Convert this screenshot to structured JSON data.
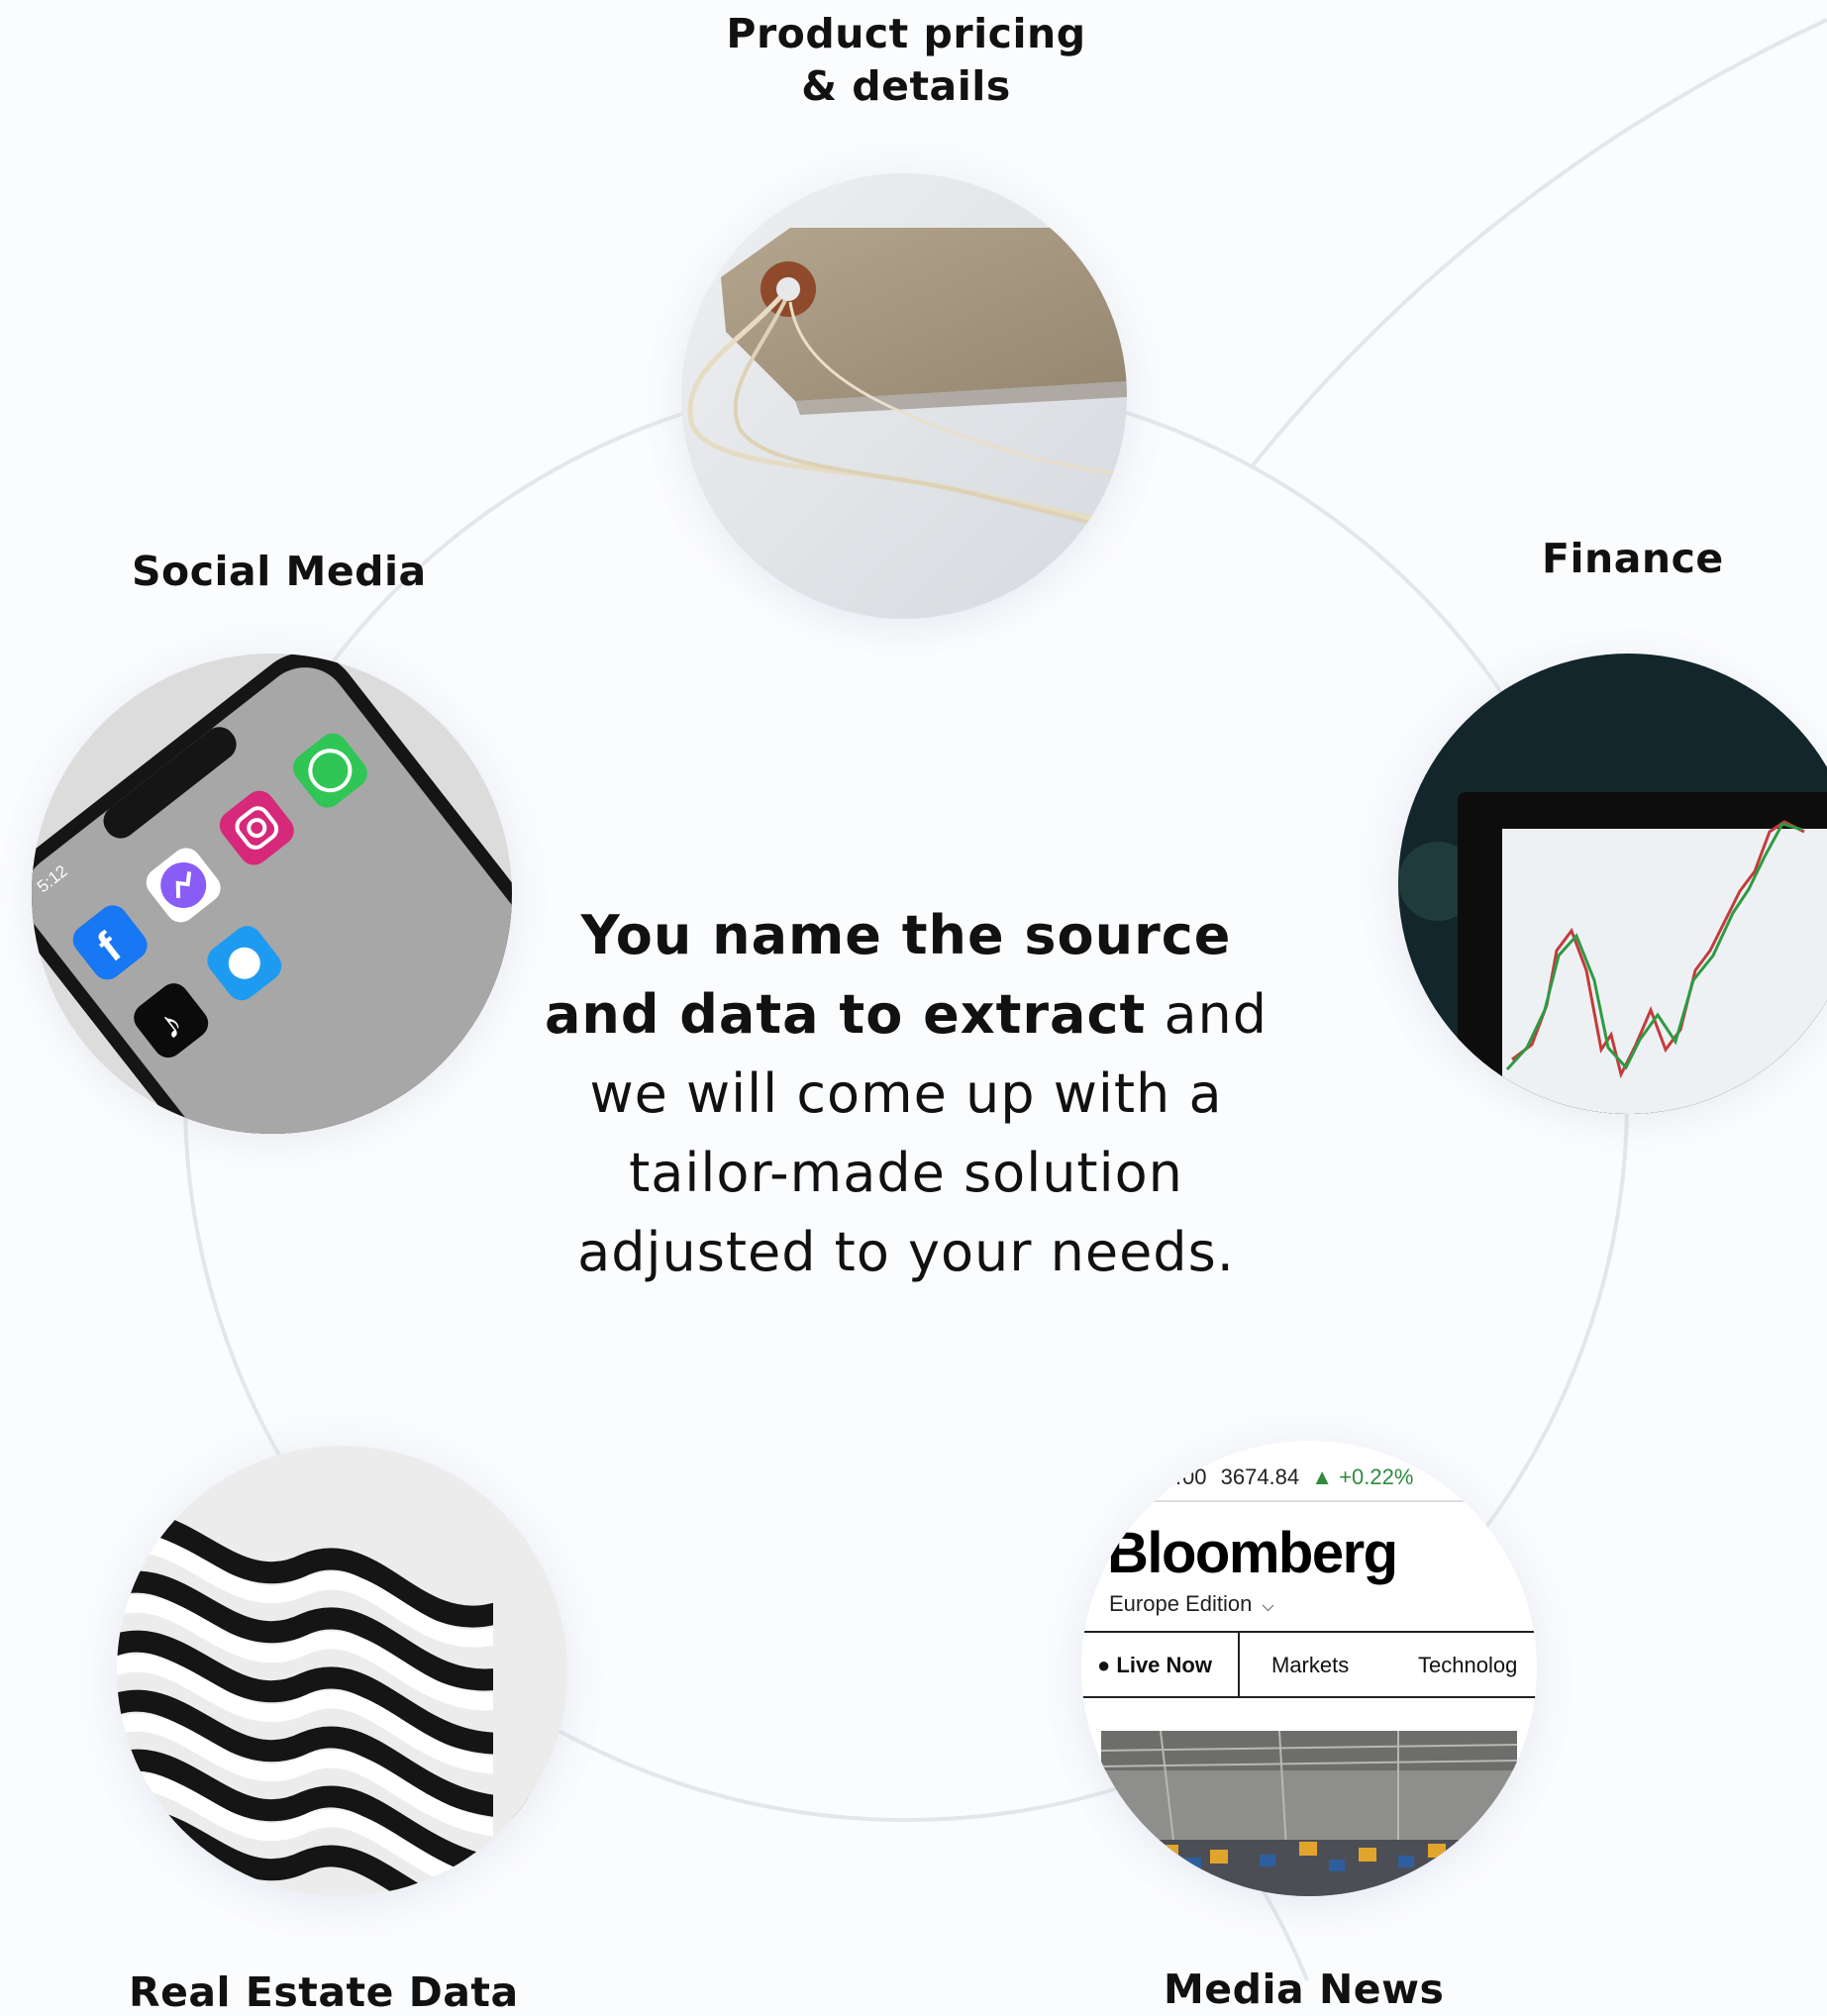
{
  "intro": {
    "bold_part": "You name the source and data to extract",
    "rest_part": " and we will come up with a tailor-made solution adjusted to your needs."
  },
  "categories": {
    "product": {
      "label_line1": "Product pricing",
      "label_line2": "& details"
    },
    "social": {
      "label": "Social Media"
    },
    "finance": {
      "label": "Finance"
    },
    "real_estate": {
      "label": "Real Estate Data"
    },
    "media": {
      "label": "Media News"
    }
  },
  "phone": {
    "time": "5:12",
    "apps": [
      "Facebook",
      "Messenger",
      "Instagram",
      "WhatsApp",
      "TikTok",
      "Twitter"
    ]
  },
  "bloomberg": {
    "ticker_prefix": "…00",
    "ticker_value": "3674.84",
    "ticker_change": "▲ +0.22%",
    "brand": "Bloomberg",
    "edition": "Europe Edition",
    "nav": [
      "● Live Now",
      "Markets",
      "Technolog"
    ]
  },
  "colors": {
    "background": "#fbfcfe",
    "ring": "#e4e6ea",
    "ticker_up": "#2e8b3e"
  }
}
